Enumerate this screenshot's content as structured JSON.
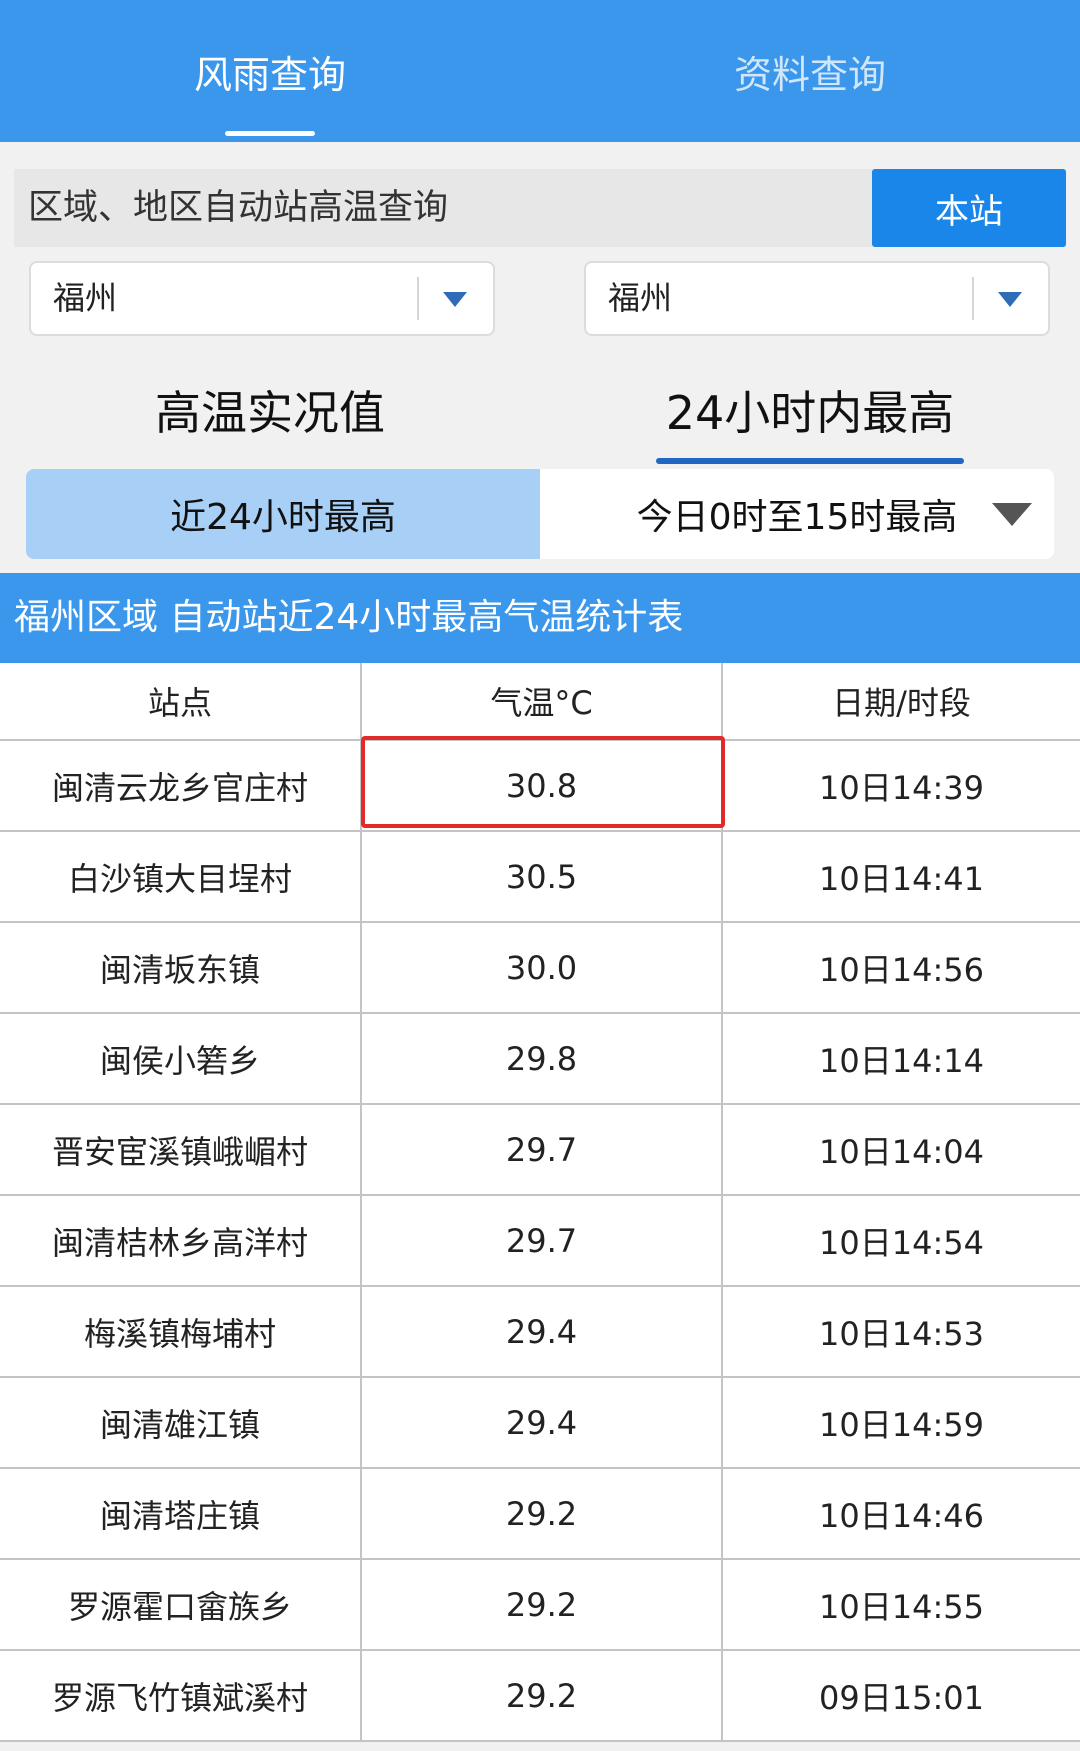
{
  "top_tabs": [
    {
      "label": "风雨查询",
      "active": true
    },
    {
      "label": "资料查询",
      "active": false
    }
  ],
  "search": {
    "title": "区域、地区自动站高温查询",
    "button_label": "本站"
  },
  "selects": [
    {
      "value": "福州"
    },
    {
      "value": "福州"
    }
  ],
  "mode_tabs": [
    {
      "label": "高温实况值",
      "active": false
    },
    {
      "label": "24小时内最高",
      "active": true
    }
  ],
  "sub_tabs": [
    {
      "label": "近24小时最高",
      "active": true
    },
    {
      "label": "今日0时至15时最高",
      "active": false
    }
  ],
  "table_title": "福州区域 自动站近24小时最高气温统计表",
  "table": {
    "headers": [
      "站点",
      "气温°C",
      "日期/时段"
    ],
    "rows": [
      [
        "闽清云龙乡官庄村",
        "30.8",
        "10日14:39"
      ],
      [
        "白沙镇大目埕村",
        "30.5",
        "10日14:41"
      ],
      [
        "闽清坂东镇",
        "30.0",
        "10日14:56"
      ],
      [
        "闽侯小箬乡",
        "29.8",
        "10日14:14"
      ],
      [
        "晋安宦溪镇峨嵋村",
        "29.7",
        "10日14:04"
      ],
      [
        "闽清桔林乡高洋村",
        "29.7",
        "10日14:54"
      ],
      [
        "梅溪镇梅埔村",
        "29.4",
        "10日14:53"
      ],
      [
        "闽清雄江镇",
        "29.4",
        "10日14:59"
      ],
      [
        "闽清塔庄镇",
        "29.2",
        "10日14:46"
      ],
      [
        "罗源霍口畲族乡",
        "29.2",
        "10日14:55"
      ],
      [
        "罗源飞竹镇斌溪村",
        "29.2",
        "09日15:01"
      ]
    ]
  },
  "colors": {
    "header_blue": "#3a97ec",
    "button_blue": "#1a86ea",
    "highlight_red": "#e32a2a",
    "subtab_active": "#a8cff5"
  }
}
